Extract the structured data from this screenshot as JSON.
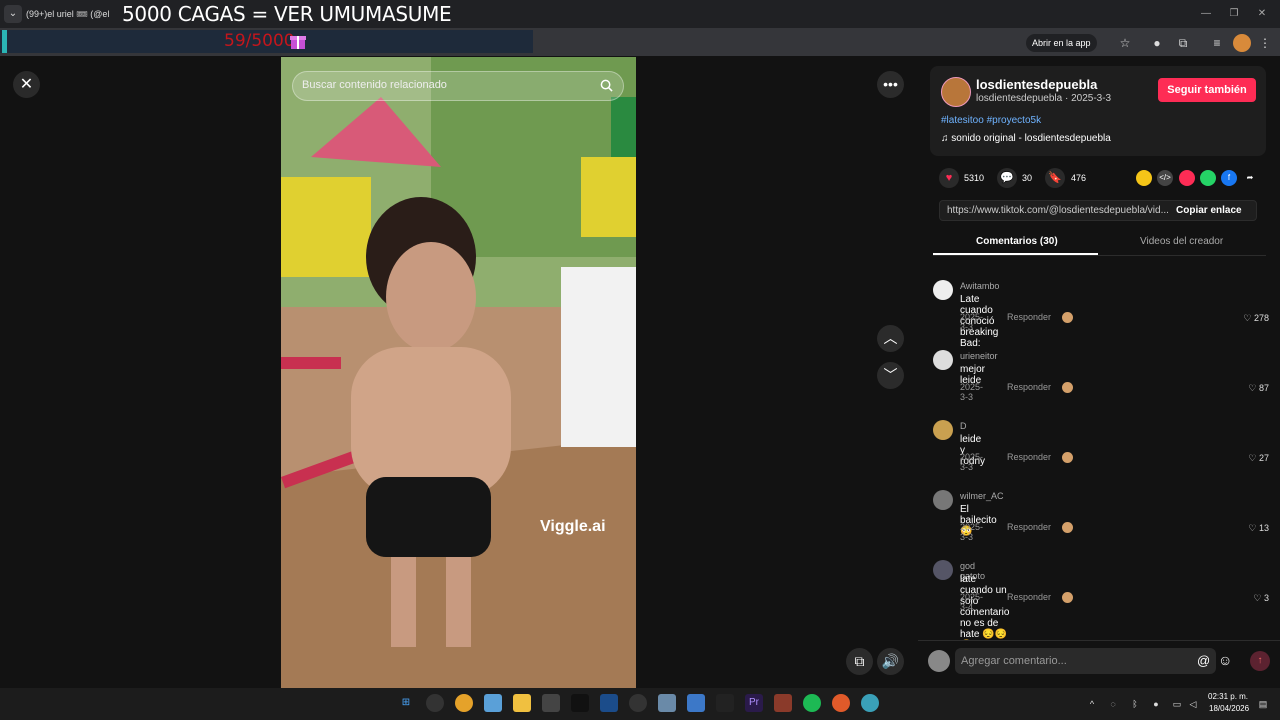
{
  "browser": {
    "tab_title": "(99+)el uriel 🎟 (@el",
    "tab_dropdown": "⌄",
    "overlay_title": "5000 CAGAS = VER UMUMASUME",
    "counter": "59/5000",
    "open_app_label": "Abrir en la app",
    "window_controls": [
      "—",
      "❐",
      "✕"
    ]
  },
  "video": {
    "search_placeholder": "Buscar contenido relacionado",
    "watermark": "Viggle.ai"
  },
  "creator": {
    "name": "losdientesdepuebla",
    "sub": "losdientesdepuebla · 2025-3-3",
    "follow_label": "Seguir también",
    "hashtags": "#latesitoo #proyecto5k",
    "sound": "sonido original - losdientesdepuebla"
  },
  "stats": {
    "likes": "5310",
    "comments": "30",
    "saves": "476"
  },
  "share": {
    "url": "https://www.tiktok.com/@losdientesdepuebla/vid...",
    "copy_label": "Copiar enlace"
  },
  "tabs": {
    "comments": "Comentarios (30)",
    "videos": "Videos del creador"
  },
  "comments": [
    {
      "user": "Awitambo",
      "text": "Late cuando conoció breaking Bad:",
      "date": "2025-3-3",
      "reply": "Responder",
      "likes": "278"
    },
    {
      "user": "urieneitor",
      "text": "mejor leide",
      "date": "2025-3-3",
      "reply": "Responder",
      "likes": "87"
    },
    {
      "user": "D",
      "text": "leide y rodny",
      "date": "2025-3-3",
      "reply": "Responder",
      "likes": "27"
    },
    {
      "user": "wilmer_AC",
      "text": "El bailecito 😳",
      "date": "2025-3-3",
      "reply": "Responder",
      "likes": "13"
    },
    {
      "user": "god gatoto",
      "text": "late cuando un solo comentario no es de hate 😔😔😔",
      "date": "2025-3-4",
      "reply": "Responder",
      "likes": "3"
    }
  ],
  "comment_input_placeholder": "Agregar comentario...",
  "taskbar": {
    "time": "02:31 p. m.",
    "date": "18/04/2026"
  },
  "colors": {
    "accent": "#fe2c55",
    "link": "#6fb3ff",
    "background": "#121212"
  }
}
